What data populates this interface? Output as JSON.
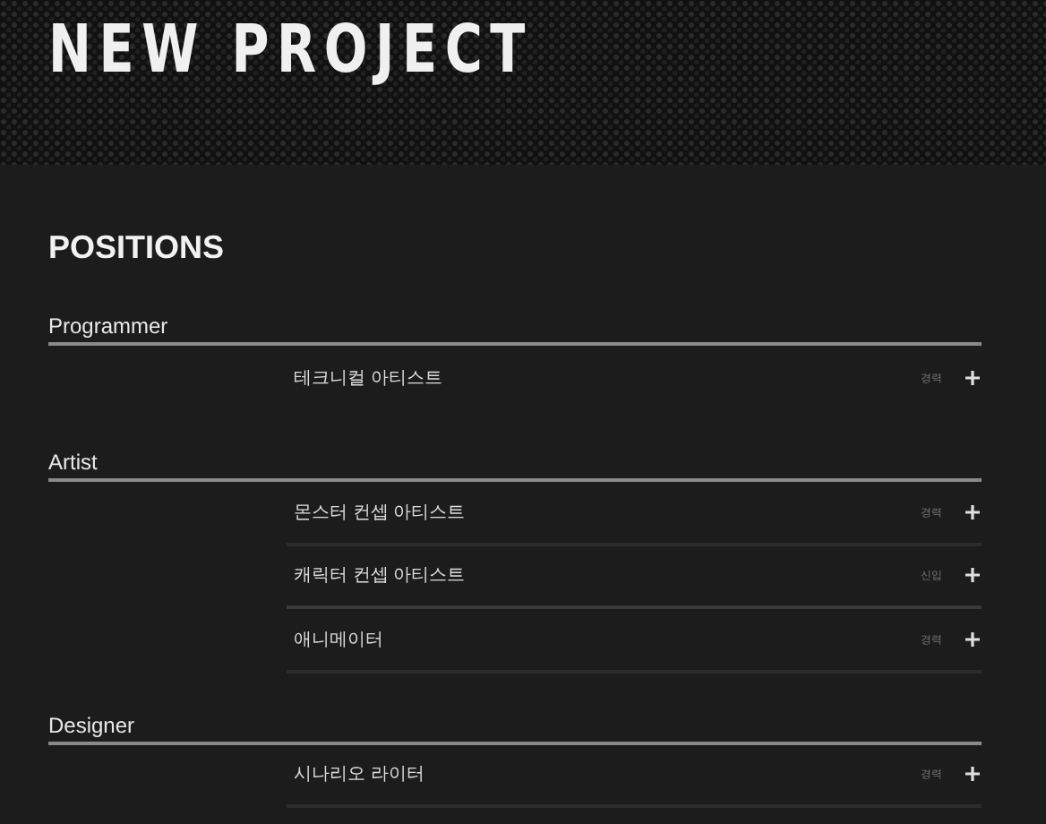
{
  "header": {
    "title": "NEW PROJECT"
  },
  "section_title": "POSITIONS",
  "groups": [
    {
      "name": "Programmer",
      "positions": [
        {
          "title": "테크니컬 아티스트",
          "tag": "경력"
        }
      ]
    },
    {
      "name": "Artist",
      "positions": [
        {
          "title": "몬스터 컨셉 아티스트",
          "tag": "경력"
        },
        {
          "title": "캐릭터 컨셉 아티스트",
          "tag": "신입"
        },
        {
          "title": "애니메이터",
          "tag": "경력"
        }
      ]
    },
    {
      "name": "Designer",
      "positions": [
        {
          "title": "시나리오 라이터",
          "tag": "경력"
        }
      ]
    }
  ]
}
